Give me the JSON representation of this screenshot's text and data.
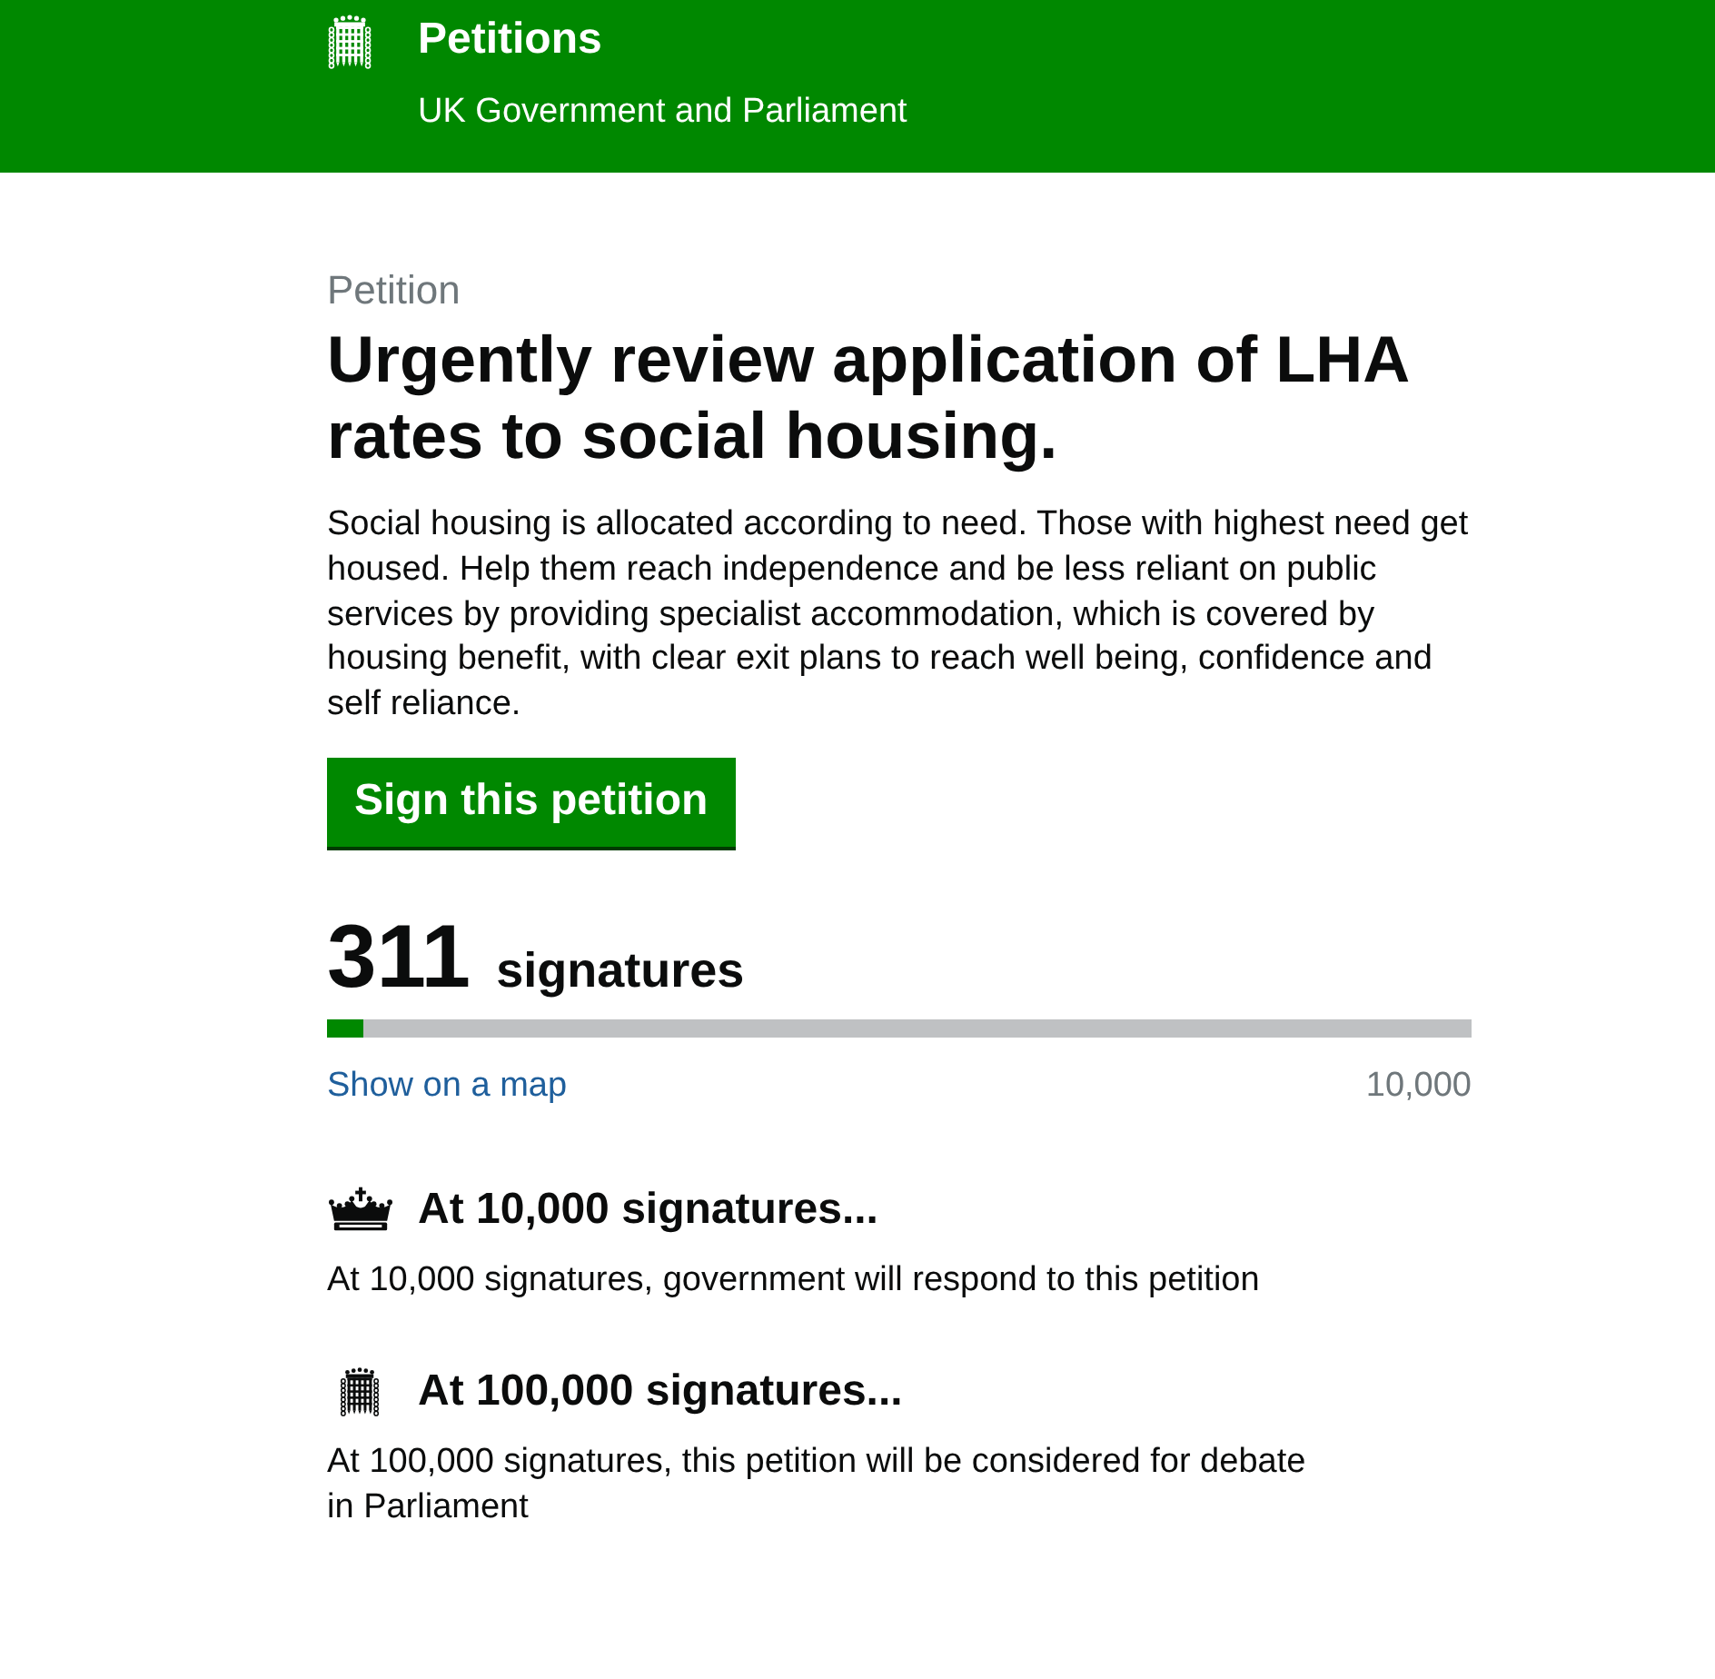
{
  "header": {
    "title": "Petitions",
    "subtitle": "UK Government and Parliament"
  },
  "petition": {
    "label": "Petition",
    "title": "Urgently review application of LHA rates to social housing.",
    "description": "Social housing is allocated according to need. Those with highest need get housed. Help them reach independence and be less reliant on public services by providing specialist accommodation, which is covered by housing benefit, with clear exit plans to reach well being, confidence and self reliance.",
    "sign_button": "Sign this petition"
  },
  "signatures": {
    "count": "311",
    "unit": "signatures",
    "level": 0.031,
    "map_link": "Show on a map",
    "target": "10,000"
  },
  "milestones": [
    {
      "kind": "government",
      "heading": "At 10,000 signatures...",
      "text": "At 10,000 signatures, government will respond to this petition"
    },
    {
      "kind": "parliament",
      "heading": "At 100,000 signatures...",
      "text": "At 100,000 signatures, this petition will be considered for debate in Parliament"
    }
  ]
}
